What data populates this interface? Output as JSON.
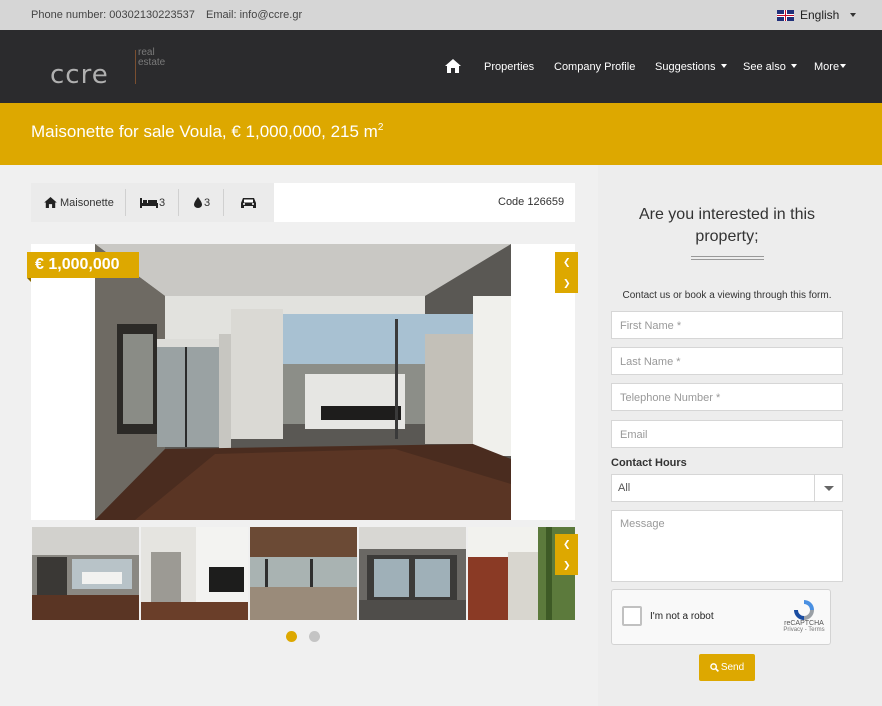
{
  "topbar": {
    "phone": "Phone number: 00302130223537",
    "email": "Email: info@ccre.gr",
    "language": "English"
  },
  "logo": {
    "main": "ccre",
    "sub_line1": "real",
    "sub_line2": "estate"
  },
  "nav": {
    "items": [
      "Properties",
      "Company Profile",
      "Suggestions",
      "See also",
      "More"
    ]
  },
  "title": {
    "text": "Maisonette for sale Voula, € 1,000,000, 215 m",
    "sup": "2"
  },
  "info": {
    "type": "Maisonette",
    "bedrooms": "3",
    "bathrooms": "3",
    "code": "Code 126659"
  },
  "listing": {
    "price": "€ 1,000,000"
  },
  "gallery": {
    "thumb_count": 5,
    "active_page": 1,
    "pages": 2
  },
  "form": {
    "title": "Are you interested in this property;",
    "subtitle": "Contact us or book a viewing through this form.",
    "first_name_placeholder": "First Name *",
    "last_name_placeholder": "Last Name *",
    "phone_placeholder": "Telephone Number *",
    "email_placeholder": "Email",
    "contact_hours_label": "Contact Hours",
    "contact_hours_value": "All",
    "message_placeholder": "Message",
    "captcha_text": "I'm not a robot",
    "captcha_brand": "reCAPTCHA",
    "captcha_links": "Privacy - Terms",
    "send_label": "Send"
  },
  "colors": {
    "accent": "#dda800",
    "nav_bg": "#2b2b2d",
    "topbar_bg": "#d6d6d6"
  }
}
